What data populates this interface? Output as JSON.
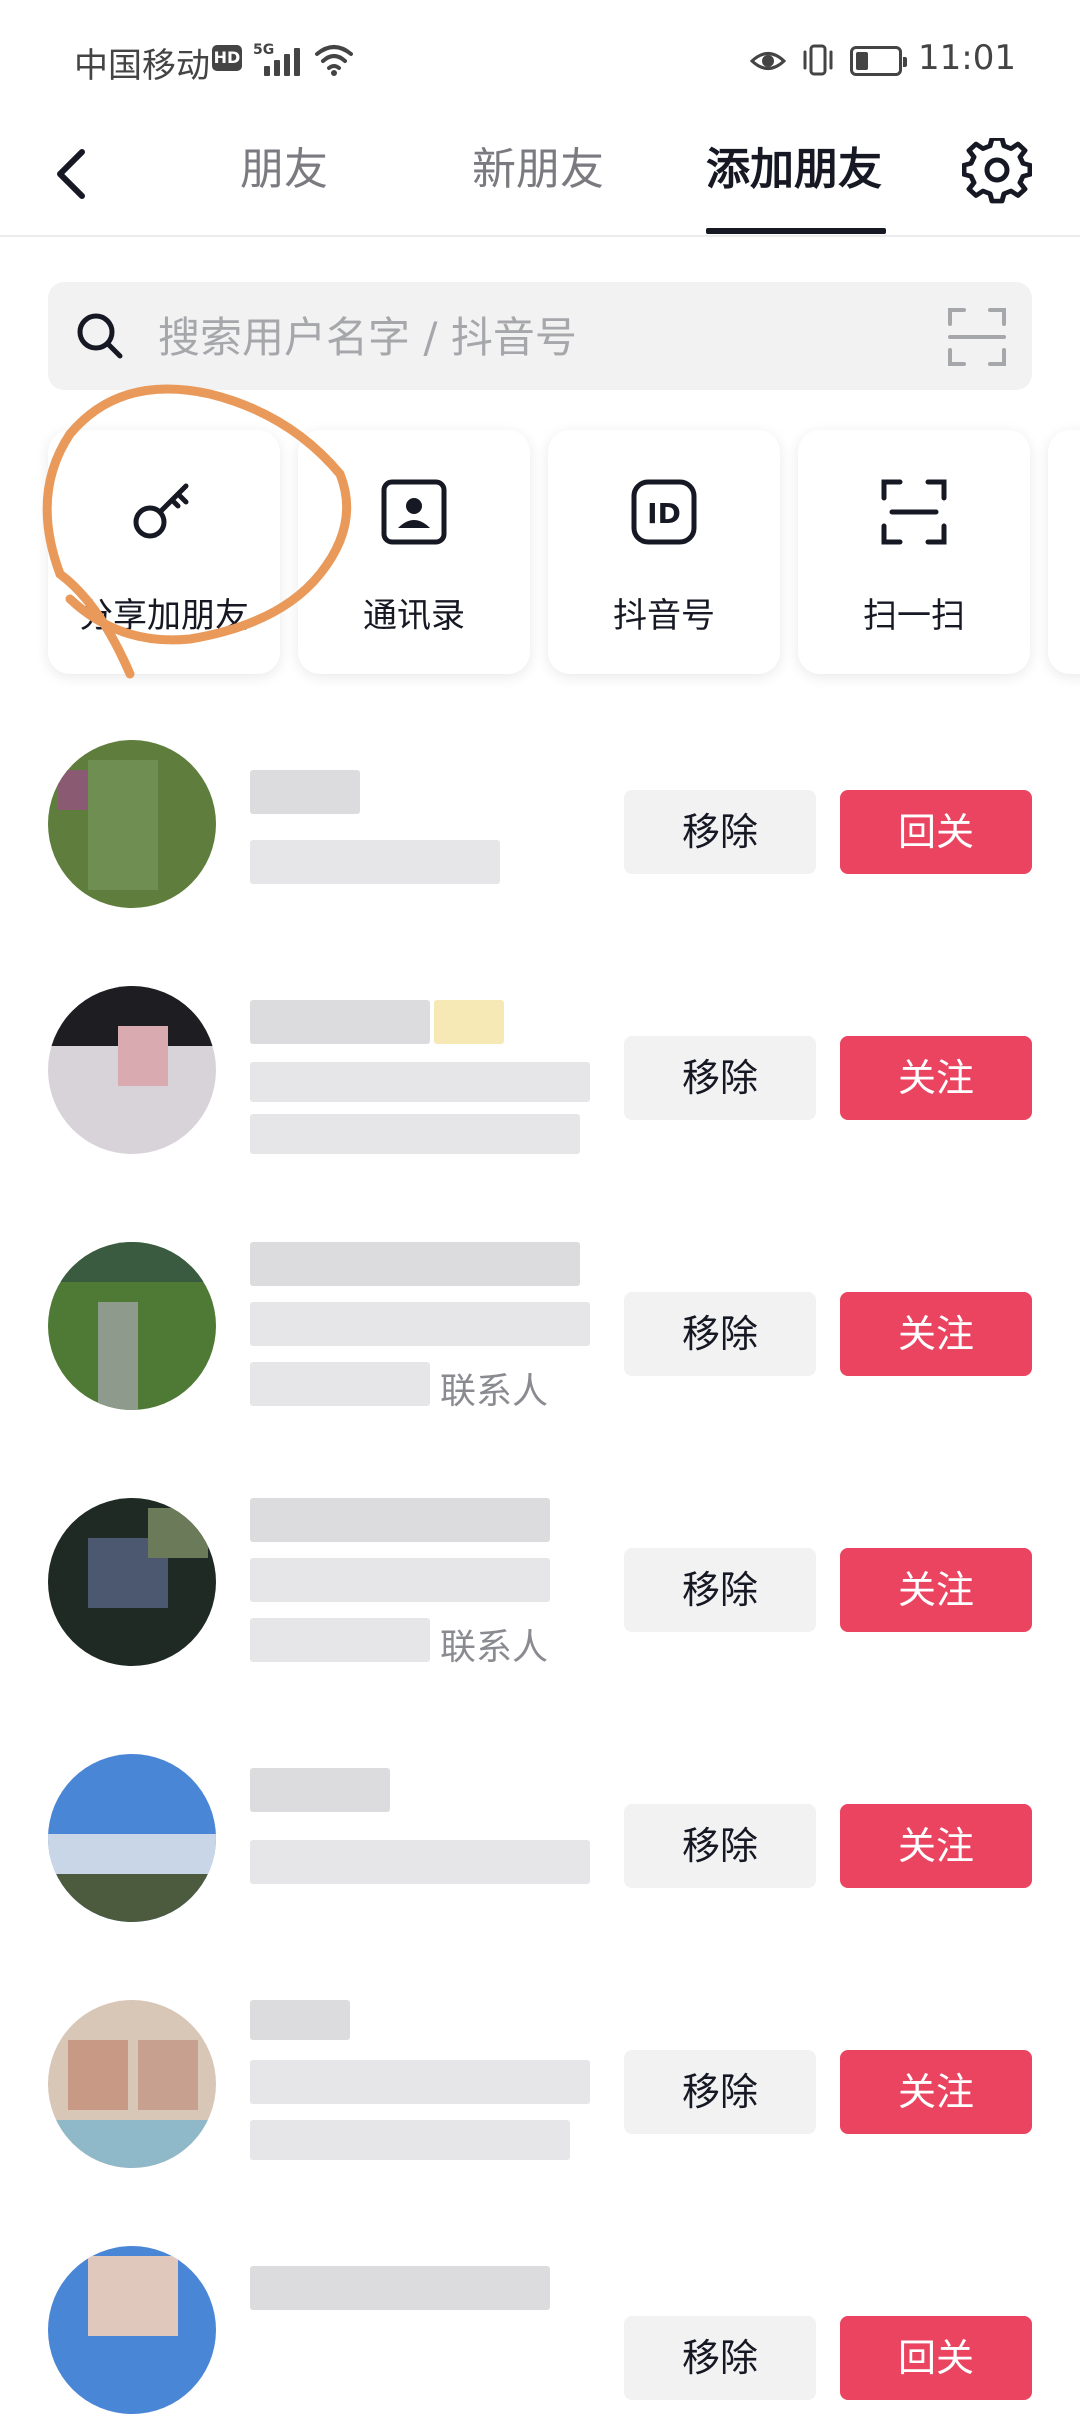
{
  "status_bar": {
    "carrier": "中国移动",
    "hd_badge": "HD",
    "network": "5G",
    "battery_level": 0.3,
    "time": "11:01"
  },
  "nav": {
    "back_icon": "chevron-left-icon",
    "tabs": [
      {
        "label": "朋友",
        "active": false
      },
      {
        "label": "新朋友",
        "active": false
      },
      {
        "label": "添加朋友",
        "active": true
      }
    ],
    "settings_icon": "gear-icon"
  },
  "search": {
    "placeholder": "搜索用户名字 / 抖音号",
    "value": "",
    "search_icon": "search-icon",
    "scan_icon": "scan-icon"
  },
  "quick_actions": [
    {
      "label": "分享加朋友",
      "icon": "key-icon"
    },
    {
      "label": "通讯录",
      "icon": "contact-book-icon"
    },
    {
      "label": "抖音号",
      "icon": "id-icon"
    },
    {
      "label": "扫一扫",
      "icon": "scan-icon"
    }
  ],
  "list": {
    "rows": [
      {
        "remove_label": "移除",
        "action_label": "回关",
        "hint": ""
      },
      {
        "remove_label": "移除",
        "action_label": "关注",
        "hint": ""
      },
      {
        "remove_label": "移除",
        "action_label": "关注",
        "hint": "联系人"
      },
      {
        "remove_label": "移除",
        "action_label": "关注",
        "hint": "联系人"
      },
      {
        "remove_label": "移除",
        "action_label": "关注",
        "hint": ""
      },
      {
        "remove_label": "移除",
        "action_label": "关注",
        "hint": ""
      },
      {
        "remove_label": "移除",
        "action_label": "回关",
        "hint": ""
      }
    ]
  },
  "colors": {
    "accent_follow": "#ea4460",
    "remove_bg": "#f2f2f3",
    "annotation_orange": "#e99a5a"
  }
}
